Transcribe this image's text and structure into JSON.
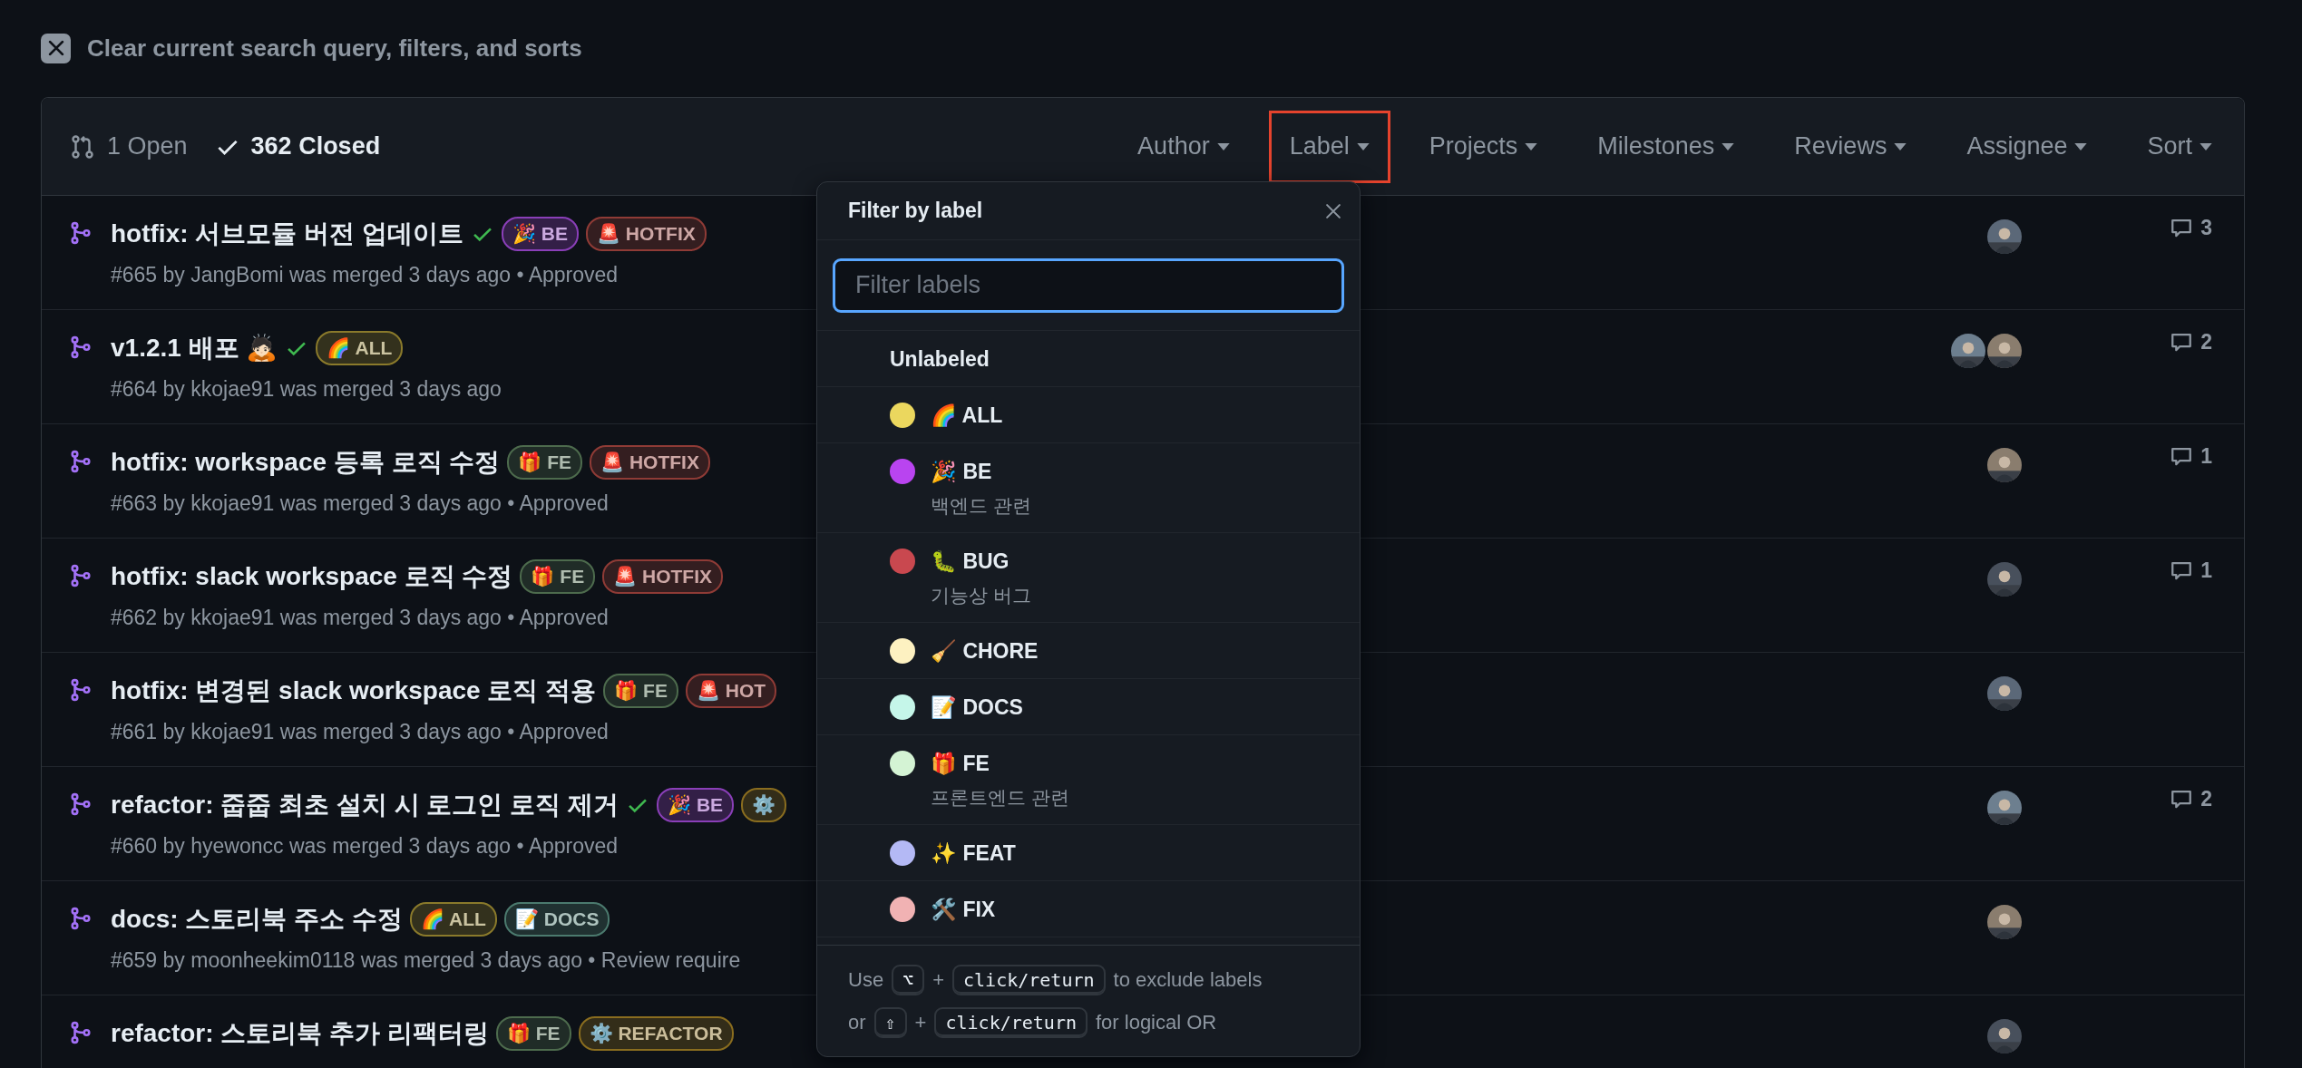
{
  "clear_filters": {
    "label": "Clear current search query, filters, and sorts"
  },
  "states": [
    {
      "label": "1 Open",
      "selected": false
    },
    {
      "label": "362 Closed",
      "selected": true
    }
  ],
  "filters": [
    {
      "label": "Author",
      "highlighted": false
    },
    {
      "label": "Label",
      "highlighted": true
    },
    {
      "label": "Projects",
      "highlighted": false
    },
    {
      "label": "Milestones",
      "highlighted": false
    },
    {
      "label": "Reviews",
      "highlighted": false
    },
    {
      "label": "Assignee",
      "highlighted": false
    },
    {
      "label": "Sort",
      "highlighted": false
    }
  ],
  "pull_requests": [
    {
      "title": "hotfix: 서브모듈 버전 업데이트",
      "checks_passed": true,
      "labels": [
        {
          "name": "🎉 BE",
          "color": "#8a3fb8"
        },
        {
          "name": "🚨 HOTFIX",
          "color": "#8f3b36"
        }
      ],
      "meta": "#665 by JangBomi was merged 3 days ago • Approved",
      "avatars": [
        {
          "kind": "picture"
        }
      ],
      "comments": "3"
    },
    {
      "title": "v1.2.1 배포 🙇🏻",
      "checks_passed": true,
      "labels": [
        {
          "name": "🌈 ALL",
          "color": "#8a7a2b"
        }
      ],
      "meta": "#664 by kkojae91 was merged 3 days ago",
      "avatars": [
        {
          "kind": "picture"
        },
        {
          "kind": "picture"
        }
      ],
      "comments": "2"
    },
    {
      "title": "hotfix: workspace 등록 로직 수정",
      "checks_passed": false,
      "labels": [
        {
          "name": "🎁 FE",
          "color": "#4d6b4d"
        },
        {
          "name": "🚨 HOTFIX",
          "color": "#8f3b36"
        }
      ],
      "meta": "#663 by kkojae91 was merged 3 days ago • Approved",
      "avatars": [
        {
          "kind": "picture"
        }
      ],
      "comments": "1"
    },
    {
      "title": "hotfix: slack workspace 로직 수정",
      "checks_passed": false,
      "labels": [
        {
          "name": "🎁 FE",
          "color": "#4d6b4d"
        },
        {
          "name": "🚨 HOTFIX",
          "color": "#8f3b36"
        }
      ],
      "meta": "#662 by kkojae91 was merged 3 days ago • Approved",
      "avatars": [
        {
          "kind": "picture"
        }
      ],
      "comments": "1"
    },
    {
      "title": "hotfix: 변경된 slack workspace 로직 적용",
      "checks_passed": false,
      "labels": [
        {
          "name": "🎁 FE",
          "color": "#4d6b4d"
        },
        {
          "name": "🚨 HOT",
          "color": "#8f3b36"
        }
      ],
      "meta": "#661 by kkojae91 was merged 3 days ago • Approved",
      "avatars": [
        {
          "kind": "picture"
        }
      ]
    },
    {
      "title": "refactor: 줍줍 최초 설치 시 로그인 로직 제거",
      "checks_passed": true,
      "labels": [
        {
          "name": "🎉 BE",
          "color": "#8a3fb8"
        },
        {
          "name": "⚙️",
          "color": "#8a6d1f"
        }
      ],
      "meta": "#660 by hyewoncc was merged 3 days ago • Approved",
      "avatars": [
        {
          "kind": "picture"
        }
      ],
      "comments": "2"
    },
    {
      "title": "docs: 스토리북 주소 수정",
      "checks_passed": false,
      "labels": [
        {
          "name": "🌈 ALL",
          "color": "#8a7a2b"
        },
        {
          "name": "📝 DOCS",
          "color": "#4b7a6e"
        }
      ],
      "meta": "#659 by moonheekim0118 was merged 3 days ago • Review require",
      "avatars": [
        {
          "kind": "picture"
        }
      ]
    },
    {
      "title": "refactor: 스토리북 추가 리팩터링",
      "checks_passed": false,
      "labels": [
        {
          "name": "🎁 FE",
          "color": "#4d6b4d"
        },
        {
          "name": "⚙️ REFACTOR",
          "color": "#8a6d1f"
        }
      ],
      "avatars": [
        {
          "kind": "picture"
        }
      ]
    }
  ],
  "label_menu": {
    "title": "Filter by label",
    "search": {
      "placeholder": "Filter labels",
      "focused": true
    },
    "items": [
      {
        "name": "Unlabeled"
      },
      {
        "name": "🌈 ALL",
        "color": "#ebd75e"
      },
      {
        "name": "🎉 BE",
        "color": "#b944f0",
        "description": "백엔드 관련"
      },
      {
        "name": "🐛 BUG",
        "color": "#c9484f",
        "description": "기능상 버그"
      },
      {
        "name": "🧹 CHORE",
        "color": "#fdf1c1"
      },
      {
        "name": "📝 DOCS",
        "color": "#c5f6e9"
      },
      {
        "name": "🎁 FE",
        "color": "#d4f3d4",
        "description": "프론트엔드 관련"
      },
      {
        "name": "✨ FEAT",
        "color": "#b4b9f5"
      },
      {
        "name": "🛠️ FIX",
        "color": "#f1b2b3"
      }
    ],
    "footer": [
      [
        {
          "kind": "text",
          "text": "Use"
        },
        {
          "kind": "key",
          "text": "⌥"
        },
        {
          "kind": "text",
          "text": "+"
        },
        {
          "kind": "key",
          "text": "click/return"
        },
        {
          "kind": "text",
          "text": "to exclude labels"
        }
      ],
      [
        {
          "kind": "text",
          "text": "or"
        },
        {
          "kind": "key",
          "text": "⇧"
        },
        {
          "kind": "text",
          "text": "+"
        },
        {
          "kind": "key",
          "text": "click/return"
        },
        {
          "kind": "text",
          "text": "for logical OR"
        }
      ]
    ]
  }
}
